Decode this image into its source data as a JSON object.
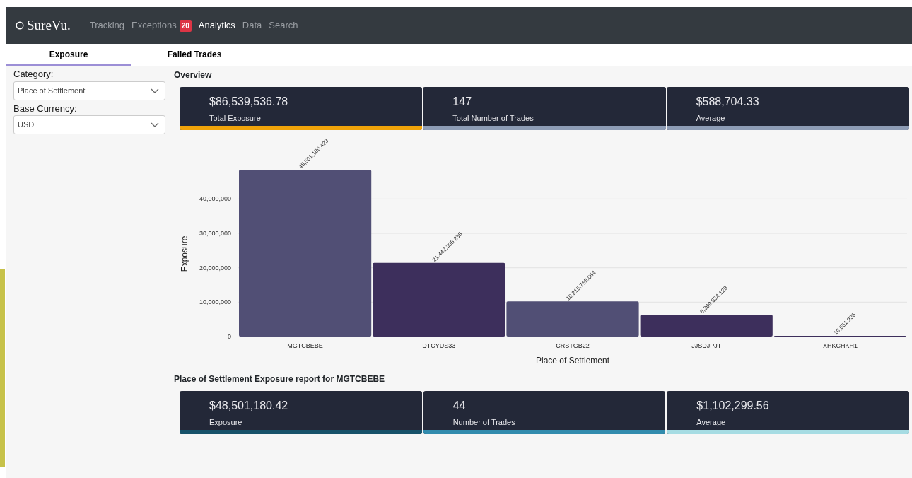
{
  "brand": "SureVu.",
  "nav": [
    {
      "label": "Tracking",
      "selected": false
    },
    {
      "label": "Exceptions",
      "selected": false,
      "badge": "20"
    },
    {
      "label": "Analytics",
      "selected": true
    },
    {
      "label": "Data",
      "selected": false
    },
    {
      "label": "Search",
      "selected": false
    }
  ],
  "tabs": [
    {
      "label": "Exposure",
      "selected": true
    },
    {
      "label": "Failed Trades",
      "selected": false
    }
  ],
  "filters": [
    {
      "label": "Category:",
      "value": "Place of Settlement"
    },
    {
      "label": "Base Currency:",
      "value": "USD"
    }
  ],
  "overview": {
    "title": "Overview",
    "cards": [
      {
        "value": "$86,539,536.78",
        "label": "Total Exposure",
        "color": "#f0a30a"
      },
      {
        "value": "147",
        "label": "Total Number of Trades",
        "color": "#8d9cb5"
      },
      {
        "value": "$588,704.33",
        "label": "Average",
        "color": "#8d9cb5"
      }
    ]
  },
  "chart_data": {
    "type": "bar",
    "xlabel": "Place of Settlement",
    "ylabel": "Exposure",
    "categories": [
      "MGTCBEBE",
      "DTCYUS33",
      "CRSTGB22",
      "JJSDJPJT",
      "XHKCHKH1"
    ],
    "values": [
      48501180.423,
      21442305.238,
      10215765.054,
      6369634.129,
      10651.936
    ],
    "colors": [
      "#514f75",
      "#3d2f5c",
      "#514f75",
      "#3d2f5c",
      "#3d2f5c"
    ],
    "grid": true,
    "ylim": [
      0,
      48501180.423
    ],
    "yticks": [
      {
        "value": 0,
        "label": "0"
      },
      {
        "value": 10000000,
        "label": "10,000,000"
      },
      {
        "value": 20000000,
        "label": "20,000,000"
      },
      {
        "value": 30000000,
        "label": "30,000,000"
      },
      {
        "value": 40000000,
        "label": "40,000,000"
      }
    ],
    "value_labels": [
      "48,501,180.423",
      "21,442,305.238",
      "10,215,765.054",
      "6,369,634.129",
      "10,651.936"
    ]
  },
  "report": {
    "title": "Place of Settlement Exposure report for MGTCBEBE",
    "cards": [
      {
        "value": "$48,501,180.42",
        "label": "Exposure",
        "color": "#17526a"
      },
      {
        "value": "44",
        "label": "Number of Trades",
        "color": "#328cae"
      },
      {
        "value": "$1,102,299.56",
        "label": "Average",
        "color": "#a6dce3"
      }
    ]
  }
}
